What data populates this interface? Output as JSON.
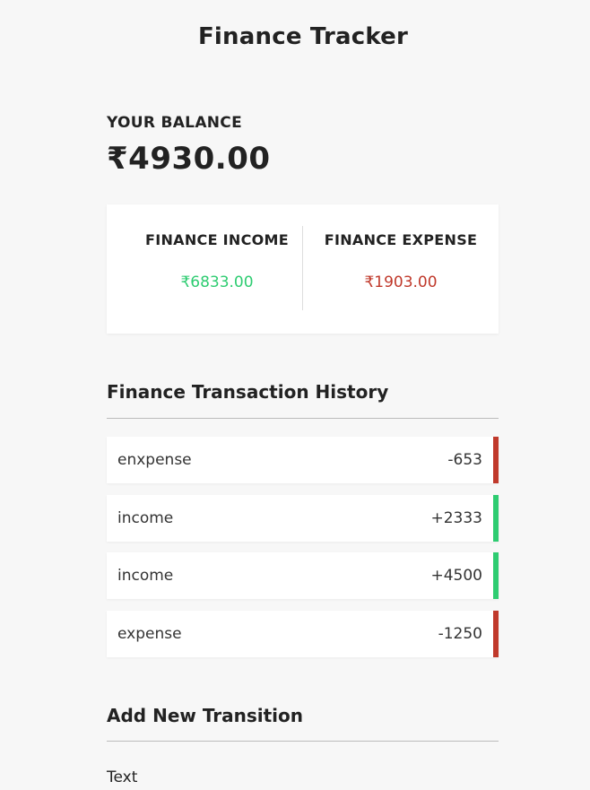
{
  "app": {
    "title": "Finance Tracker"
  },
  "balance": {
    "label": "YOUR BALANCE",
    "amount": "₹4930.00"
  },
  "summary": {
    "income_label": "FINANCE INCOME",
    "income_value": "₹6833.00",
    "expense_label": "FINANCE EXPENSE",
    "expense_value": "₹1903.00"
  },
  "history": {
    "heading": "Finance Transaction History",
    "items": [
      {
        "text": "enxpense",
        "amount": "-653",
        "type": "minus"
      },
      {
        "text": "income",
        "amount": "+2333",
        "type": "plus"
      },
      {
        "text": "income",
        "amount": "+4500",
        "type": "plus"
      },
      {
        "text": "expense",
        "amount": "-1250",
        "type": "minus"
      }
    ]
  },
  "form": {
    "heading": "Add New Transition",
    "text_label": "Text"
  },
  "colors": {
    "background": "#f7f7f7",
    "income": "#2ecc71",
    "expense": "#c0392b"
  }
}
